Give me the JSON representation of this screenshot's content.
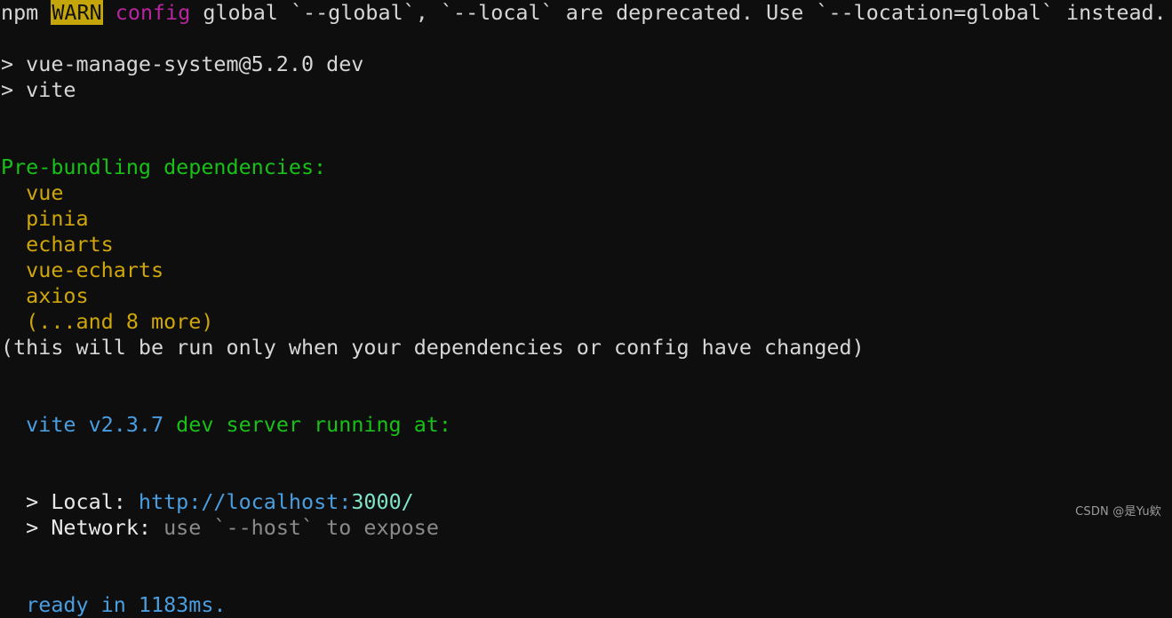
{
  "terminal": {
    "background_color": "#0e0e0e",
    "default_text_color": "#d6d6d6",
    "lines": [
      {
        "id": "npm-warn-line",
        "segments": [
          {
            "text": "npm ",
            "style": "default"
          },
          {
            "text": "WARN",
            "style": "warn-badge"
          },
          {
            "text": " ",
            "style": "default"
          },
          {
            "text": "config",
            "style": "magenta"
          },
          {
            "text": " global `--global`, `--local` are deprecated. Use `--location=global` instead.",
            "style": "default"
          }
        ]
      },
      {
        "id": "blank-1",
        "segments": [
          {
            "text": " ",
            "style": "default"
          }
        ]
      },
      {
        "id": "script-name-line",
        "segments": [
          {
            "text": "> vue-manage-system@5.2.0 dev",
            "style": "default"
          }
        ]
      },
      {
        "id": "script-command-line",
        "segments": [
          {
            "text": "> vite",
            "style": "default"
          }
        ]
      },
      {
        "id": "blank-2",
        "segments": [
          {
            "text": " ",
            "style": "default"
          }
        ]
      },
      {
        "id": "blank-3",
        "segments": [
          {
            "text": " ",
            "style": "default"
          }
        ]
      },
      {
        "id": "prebundle-header-line",
        "segments": [
          {
            "text": "Pre-bundling dependencies:",
            "style": "green"
          }
        ]
      },
      {
        "id": "dependency-vue",
        "segments": [
          {
            "text": "  vue",
            "style": "amber"
          }
        ]
      },
      {
        "id": "dependency-pinia",
        "segments": [
          {
            "text": "  pinia",
            "style": "amber"
          }
        ]
      },
      {
        "id": "dependency-echarts",
        "segments": [
          {
            "text": "  echarts",
            "style": "amber"
          }
        ]
      },
      {
        "id": "dependency-vue-echarts",
        "segments": [
          {
            "text": "  vue-echarts",
            "style": "amber"
          }
        ]
      },
      {
        "id": "dependency-axios",
        "segments": [
          {
            "text": "  axios",
            "style": "amber"
          }
        ]
      },
      {
        "id": "dependency-more",
        "segments": [
          {
            "text": "  (...and 8 more)",
            "style": "amber"
          }
        ]
      },
      {
        "id": "prebundle-note-line",
        "segments": [
          {
            "text": "(this will be run only when your dependencies or config have changed)",
            "style": "default"
          }
        ]
      },
      {
        "id": "blank-4",
        "segments": [
          {
            "text": " ",
            "style": "default"
          }
        ]
      },
      {
        "id": "blank-5",
        "segments": [
          {
            "text": " ",
            "style": "default"
          }
        ]
      },
      {
        "id": "vite-banner-line",
        "segments": [
          {
            "text": "  vite v2.3.7",
            "style": "blue"
          },
          {
            "text": " dev server running at:",
            "style": "green"
          }
        ]
      },
      {
        "id": "blank-6",
        "segments": [
          {
            "text": " ",
            "style": "default"
          }
        ]
      },
      {
        "id": "blank-7",
        "segments": [
          {
            "text": " ",
            "style": "default"
          }
        ]
      },
      {
        "id": "local-url-line",
        "segments": [
          {
            "text": "  > ",
            "style": "bright"
          },
          {
            "text": "Local: ",
            "style": "bright"
          },
          {
            "text": "http://localhost:",
            "style": "blue"
          },
          {
            "text": "3000/",
            "style": "cyan"
          }
        ]
      },
      {
        "id": "network-url-line",
        "segments": [
          {
            "text": "  > ",
            "style": "bright"
          },
          {
            "text": "Network: ",
            "style": "bright"
          },
          {
            "text": "use `--host` to expose",
            "style": "dim"
          }
        ]
      },
      {
        "id": "blank-8",
        "segments": [
          {
            "text": " ",
            "style": "default"
          }
        ]
      },
      {
        "id": "blank-9",
        "segments": [
          {
            "text": " ",
            "style": "default"
          }
        ]
      },
      {
        "id": "ready-line",
        "segments": [
          {
            "text": "  ready in 1183ms.",
            "style": "blue"
          }
        ]
      }
    ]
  },
  "watermark": {
    "text": "CSDN @是Yu欸"
  },
  "colors": {
    "background": "#0e0e0e",
    "default": "#d6d6d6",
    "bright": "#e8e8e8",
    "dim": "#8a8a8a",
    "magenta": "#b5259e",
    "green": "#18c018",
    "amber": "#cfa60a",
    "blue": "#4a9ee0",
    "cyan": "#7fe3c8",
    "warn_badge_background": "#c5a60a",
    "warn_badge_text": "#111111"
  }
}
